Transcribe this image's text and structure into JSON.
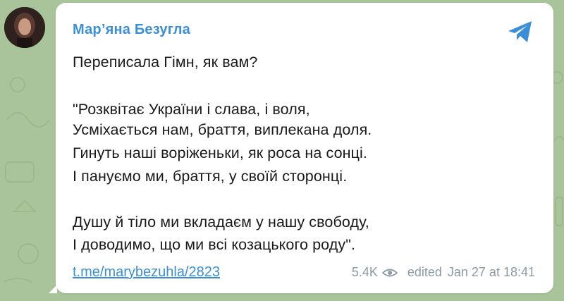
{
  "message": {
    "author": "Мар’яна Безугла",
    "lines": [
      "Переписала Гімн, як вам?",
      "\"Розквітає України і слава, і воля,",
      "Усміхається нам, браття, виплекана доля.",
      "Гинуть наші воріженьки, як роса на сонці.",
      "І пануємо ми, браття, у своїй сторонці.",
      "Душу й тіло ми вкладаєм у нашу свободу,",
      "І доводимо, що ми всі козацького роду\"."
    ],
    "link": "t.me/marybezuhla/2823",
    "views": "5.4K",
    "status": "edited",
    "datetime": "Jan 27 at 18:41"
  },
  "icons": {
    "share": "telegram-share-icon",
    "views": "eye-icon",
    "avatar": "avatar"
  },
  "colors": {
    "background": "#a9c49a",
    "accent": "#3a8fd8",
    "meta": "#8a9aa6",
    "text": "#1a1a1a"
  }
}
